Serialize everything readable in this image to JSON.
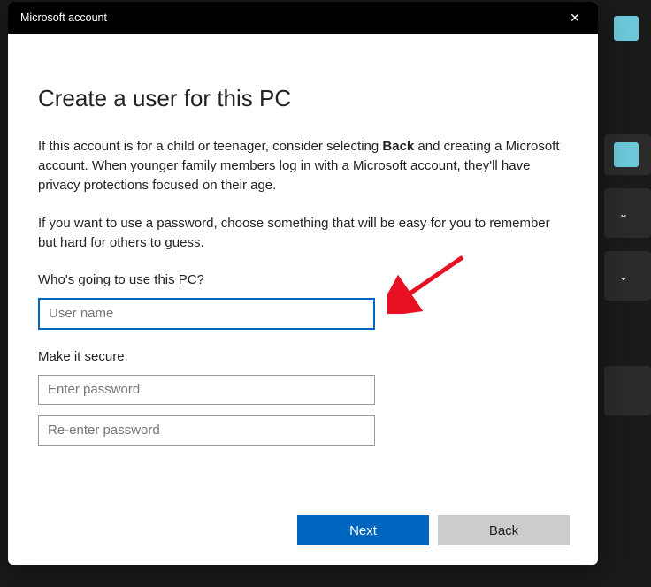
{
  "window": {
    "title": "Microsoft account"
  },
  "page": {
    "heading": "Create a user for this PC",
    "para1_pre": "If this account is for a child or teenager, consider selecting ",
    "para1_bold": "Back",
    "para1_post": " and creating a Microsoft account. When younger family members log in with a Microsoft account, they'll have privacy protections focused on their age.",
    "para2": "If you want to use a password, choose something that will be easy for you to remember but hard for others to guess.",
    "who_label": "Who's going to use this PC?",
    "secure_label": "Make it secure."
  },
  "fields": {
    "username": {
      "placeholder": "User name",
      "value": ""
    },
    "password": {
      "placeholder": "Enter password",
      "value": ""
    },
    "password2": {
      "placeholder": "Re-enter password",
      "value": ""
    }
  },
  "buttons": {
    "next": "Next",
    "back": "Back"
  }
}
